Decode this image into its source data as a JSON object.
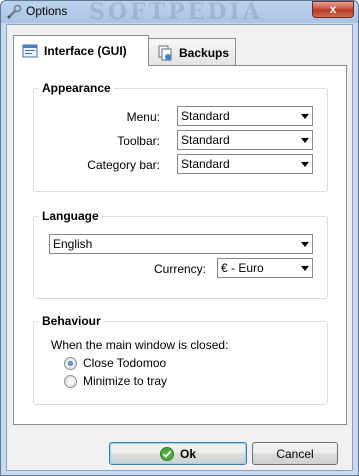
{
  "window": {
    "title": "Options",
    "watermark": "SOFTPEDIA",
    "close_label": "x"
  },
  "tabs": [
    {
      "label": "Interface (GUI)",
      "icon": "interface-icon",
      "active": true
    },
    {
      "label": "Backups",
      "icon": "backups-icon",
      "active": false
    }
  ],
  "appearance": {
    "title": "Appearance",
    "menu_label": "Menu:",
    "menu_value": "Standard",
    "toolbar_label": "Toolbar:",
    "toolbar_value": "Standard",
    "category_bar_label": "Category bar:",
    "category_bar_value": "Standard"
  },
  "language": {
    "title": "Language",
    "language_value": "English",
    "currency_label": "Currency:",
    "currency_value": "€ - Euro"
  },
  "behaviour": {
    "title": "Behaviour",
    "prompt": "When the main window is closed:",
    "options": [
      {
        "label": "Close Todomoo",
        "checked": true
      },
      {
        "label": "Minimize to tray",
        "checked": false
      }
    ]
  },
  "buttons": {
    "ok_label": "Ok",
    "cancel_label": "Cancel"
  }
}
